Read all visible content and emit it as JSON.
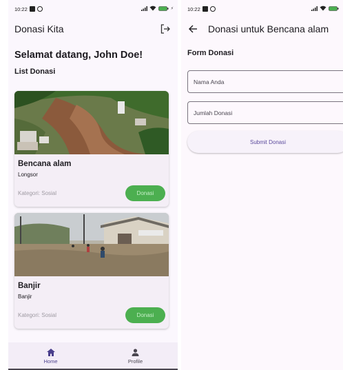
{
  "status_bar": {
    "time": "10:22",
    "battery": "100"
  },
  "home": {
    "title": "Donasi Kita",
    "welcome": "Selamat datang, John Doe!",
    "section_title": "List Donasi",
    "cards": [
      {
        "title": "Bencana alam",
        "subtitle": "Longsor",
        "category": "Kategori: Sosial",
        "button": "Donasi",
        "image": "landslide-photo"
      },
      {
        "title": "Banjir",
        "subtitle": "Banjir",
        "category": "Kategori: Sosial",
        "button": "Donasi",
        "image": "flood-photo"
      }
    ],
    "nav": [
      {
        "label": "Home",
        "icon": "home-icon"
      },
      {
        "label": "Profile",
        "icon": "person-icon"
      }
    ]
  },
  "form_screen": {
    "title": "Donasi untuk Bencana alam",
    "form_title": "Form Donasi",
    "name_placeholder": "Nama Anda",
    "amount_placeholder": "Jumlah Donasi",
    "submit": "Submit Donasi"
  },
  "colors": {
    "background": "#fbf7fd",
    "donate_button": "#4caf50",
    "accent": "#4a3f8c",
    "card": "#f4eef6"
  }
}
